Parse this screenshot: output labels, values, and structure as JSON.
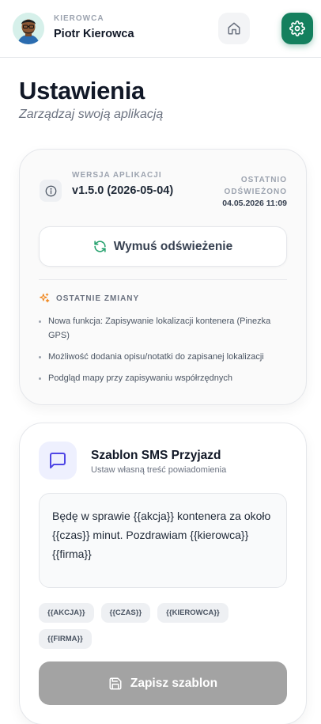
{
  "header": {
    "role": "KIEROWCA",
    "name": "Piotr Kierowca"
  },
  "page": {
    "title": "Ustawienia",
    "subtitle": "Zarządzaj swoją aplikacją"
  },
  "version_card": {
    "version_label": "WERSJA APLIKACJI",
    "version_value": "v1.5.0 (2026-05-04)",
    "refresh_label": "OSTATNIO ODŚWIEŻONO",
    "refresh_date": "04.05.2026 11:09",
    "force_button": "Wymuś odświeżenie",
    "changes_label": "OSTATNIE ZMIANY",
    "changes": [
      "Nowa funkcja: Zapisywanie lokalizacji kontenera (Pinezka GPS)",
      "Możliwość dodania opisu/notatki do zapisanej lokalizacji",
      "Podgląd mapy przy zapisywaniu współrzędnych"
    ]
  },
  "sms_card": {
    "title": "Szablon SMS Przyjazd",
    "subtitle": "Ustaw własną treść powiadomienia",
    "template_text": "Będę w sprawie {{akcja}} kontenera za około {{czas}} minut. Pozdrawiam {{kierowca}} {{firma}}",
    "tags": [
      "{{AKCJA}}",
      "{{CZAS}}",
      "{{KIEROWCA}}",
      "{{FIRMA}}"
    ],
    "save_button": "Zapisz szablon"
  },
  "colors": {
    "accent_green": "#14805e",
    "disabled_button": "#a3a3a3",
    "refresh_icon": "#22a06b",
    "chat_icon": "#4f46e5",
    "sparkle_icon": "#f08a24"
  },
  "icons": {
    "home": "home-icon",
    "settings": "gear-icon",
    "info": "info-icon",
    "refresh": "refresh-icon",
    "sparkles": "sparkles-icon",
    "chat": "chat-bubble-icon",
    "save": "save-icon"
  }
}
